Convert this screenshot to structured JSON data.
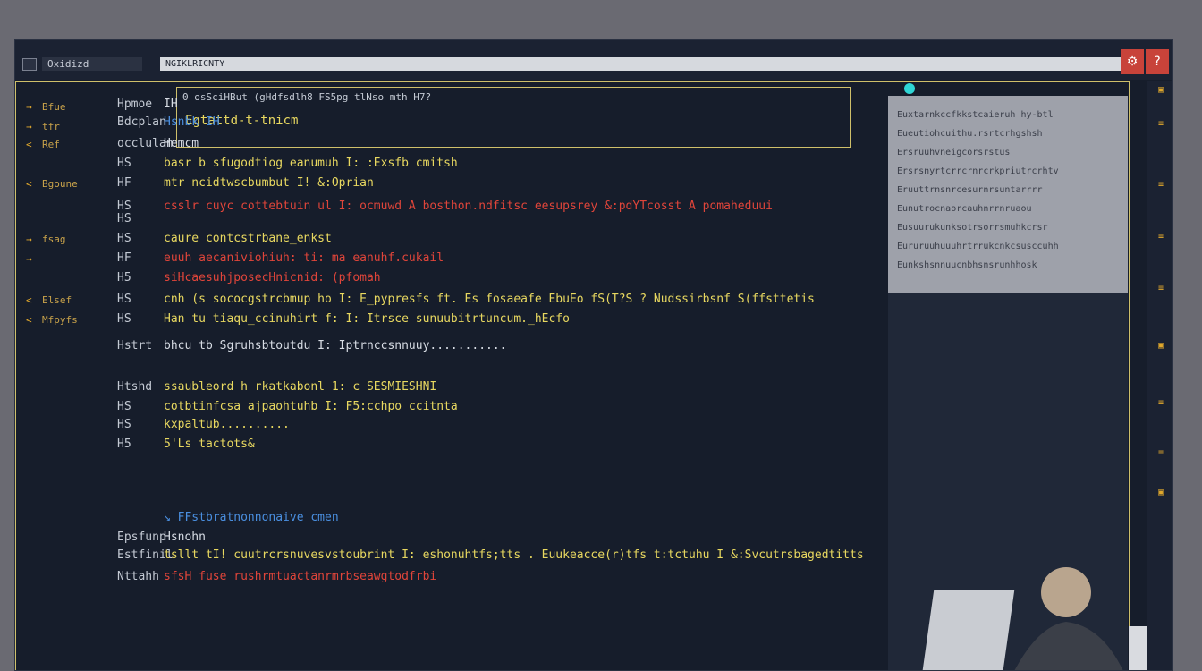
{
  "window": {
    "app_name": "Oxidizd",
    "address": "NGIKLRICNTY",
    "close_label": "?"
  },
  "panel": {
    "header": "0 osSciHBut (gHdfsdlh8 FS5pg tlNso mth H7?",
    "title": "Egtattd-t-tnicm"
  },
  "gutter": [
    {
      "marker": "→",
      "label": "Bfue"
    },
    {
      "marker": "→",
      "label": "tfr"
    },
    {
      "marker": "<",
      "label": "Ref"
    },
    {
      "marker": "<",
      "label": "Bgoune"
    },
    {
      "marker": "→",
      "label": "fsag"
    },
    {
      "marker": "→",
      "label": ""
    },
    {
      "marker": "<",
      "label": "Elsef"
    },
    {
      "marker": "<",
      "label": "Mfpyfs"
    }
  ],
  "code": [
    {
      "ln": "Hpmoe",
      "text": "IH",
      "color": "white"
    },
    {
      "ln": "Bdcplan",
      "text": "Hsnbk IH",
      "color": "blue"
    },
    {
      "ln": "occlulan",
      "text": "Hemcm",
      "color": "white"
    },
    {
      "ln": "HS",
      "text": "basr b sfugodtiog eanumuh I: :Exsfb cmitsh",
      "color": "yellow"
    },
    {
      "ln": "HF",
      "text": "mtr ncidtwscbumbut I! &:Oprian",
      "color": "yellow"
    },
    {
      "ln": "HS",
      "text": "csslr cuyc cottebtuin ul  I: ocmuwd  A  bosthon.ndfitsc eesupsrey  &:pdYTcosst  A  pomaheduui",
      "color": "red"
    },
    {
      "ln": "HS",
      "text": "",
      "color": "white"
    },
    {
      "ln": "HS",
      "text": "caure contcstrbane_enkst",
      "color": "yellow"
    },
    {
      "ln": "HF",
      "text": "euuh aecaniviohiuh: ti: ma eanuhf.cukail",
      "color": "red"
    },
    {
      "ln": "H5",
      "text": "siHcaesuhjposecHnicnid: (pfomah",
      "color": "red"
    },
    {
      "ln": "HS",
      "text": "cnh (s sococgstrcbmup ho  I: E_pypresfs ft. Es fosaeafe EbuEo fS(T?S  ?  Nudssirbsnf S(ffsttetis",
      "color": "yellow"
    },
    {
      "ln": "HS",
      "text": "Han tu tiaqu_ccinuhirt f:  I: Itrsce sunuubitrtuncum._hEcfo",
      "color": "yellow"
    },
    {
      "ln": "Hstrt",
      "text": "bhcu tb Sgruhsbtoutdu  I: Iptrnccsnnuuy...........",
      "color": "white"
    },
    {
      "ln": "Htshd",
      "text": "ssaubleord h rkatkabonl 1: c SESMIESHNI",
      "color": "yellow"
    },
    {
      "ln": "HS",
      "text": "cotbtinfcsa ajpaohtuhb  I: F5:cchpo ccitnta",
      "color": "yellow"
    },
    {
      "ln": "HS",
      "text": "kxpaltub..........",
      "color": "yellow"
    },
    {
      "ln": "H5",
      "text": "5'Ls tactots&",
      "color": "yellow"
    },
    {
      "ln": "",
      "text": "↘ FFstbratnonnonaive cmen",
      "color": "blue"
    },
    {
      "ln": "Epsfunp",
      "text": "Hsnohn",
      "color": "white"
    },
    {
      "ln": "Estfinil",
      "text": "tsllt  tI! cuutrcrsnuvesvstoubrint  I: eshonuhtfs;tts . Euukeacce(r)tfs  t:tctuhu  I  &:Svcutrsbagedtitts",
      "color": "yellow"
    },
    {
      "ln": "Nttahh",
      "text": "sfsH  fuse rushrmtuactanrmrbseawgtodfrbi",
      "color": "red"
    }
  ],
  "right_pane": [
    "Euxtarnkccfkkstcaieruh hy-btl",
    "Eueutiohcuithu.rsrtcrhgshsh",
    "Ersruuhvneigcorsrstus",
    "Ersrsnyrtcrrcrnrcrkpriutrcrhtv",
    "Eruuttrnsnrcesurnrsuntarrrr",
    "Eunutrocnaorcauhnrrnruaou",
    "Eusuurukunksotrsorrsmuhkcrsr",
    "Eururuuhuuuhrtrrukcnkcsusccuhh",
    "Eunkshsnnuucnbhsnsrunhhosk"
  ],
  "sidebar_icons": [
    "▣",
    "≡",
    "≡",
    "≡",
    "≡",
    "▣",
    "≡",
    "≡",
    "▣"
  ],
  "colors": {
    "accent": "#cfc06a",
    "editor_bg": "#161d2b",
    "error": "#e0453a",
    "keyword": "#e8d860",
    "link": "#4a8fe0"
  }
}
